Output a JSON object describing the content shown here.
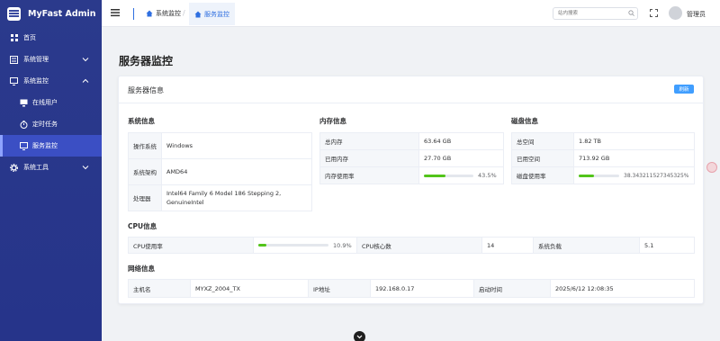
{
  "app": {
    "title": "MyFast Admin"
  },
  "sidebar": {
    "items": [
      {
        "label": "首页",
        "icon": "grid-icon"
      },
      {
        "label": "系统管理",
        "icon": "settings-panel-icon"
      },
      {
        "label": "系统监控",
        "icon": "monitor-icon"
      },
      {
        "label": "系统工具",
        "icon": "gear-icon"
      }
    ],
    "sub_items": [
      {
        "label": "在线用户",
        "icon": "online-user-icon"
      },
      {
        "label": "定时任务",
        "icon": "timer-icon"
      },
      {
        "label": "服务监控",
        "icon": "monitor-icon",
        "active": true
      }
    ]
  },
  "header": {
    "tabs": [
      {
        "label": "系统监控"
      },
      {
        "label": "服务监控"
      }
    ],
    "search_placeholder": "站内搜索",
    "username": "管理员"
  },
  "page": {
    "title": "服务器监控",
    "card_title": "服务器信息",
    "refresh_label": "刷新"
  },
  "system": {
    "title": "系统信息",
    "rows": [
      {
        "k": "操作系统",
        "v": "Windows"
      },
      {
        "k": "系统架构",
        "v": "AMD64"
      },
      {
        "k": "处理器",
        "v": "Intel64 Family 6 Model 186 Stepping 2, GenuineIntel"
      }
    ]
  },
  "memory": {
    "title": "内存信息",
    "total_label": "总内存",
    "total": "63.64 GB",
    "used_label": "已用内存",
    "used": "27.70 GB",
    "usage_label": "内存使用率",
    "usage_text": "43.5%",
    "usage": 0.435
  },
  "disk": {
    "title": "磁盘信息",
    "total_label": "总空间",
    "total": "1.82 TB",
    "used_label": "已用空间",
    "used": "713.92 GB",
    "usage_label": "磁盘使用率",
    "usage_text": "38.3432115273453​25%",
    "usage": 0.383
  },
  "cpu": {
    "title": "CPU信息",
    "usage_label": "CPU使用率",
    "usage_text": "10.9%",
    "usage": 0.109,
    "cores_label": "CPU核心数",
    "cores": "14",
    "load_label": "系统负载",
    "load": "5.1"
  },
  "network": {
    "title": "网络信息",
    "host_label": "主机名",
    "host": "MYXZ_2004_TX",
    "ip_label": "IP地址",
    "ip": "192.168.0.17",
    "boot_label": "启动时间",
    "boot": "2025/6/12 12:08:35"
  },
  "colors": {
    "sidebar": "#2b3a8c",
    "active": "#3b4fc4",
    "accent": "#2f6fe0",
    "progress": "#52c41a",
    "button": "#409eff"
  }
}
